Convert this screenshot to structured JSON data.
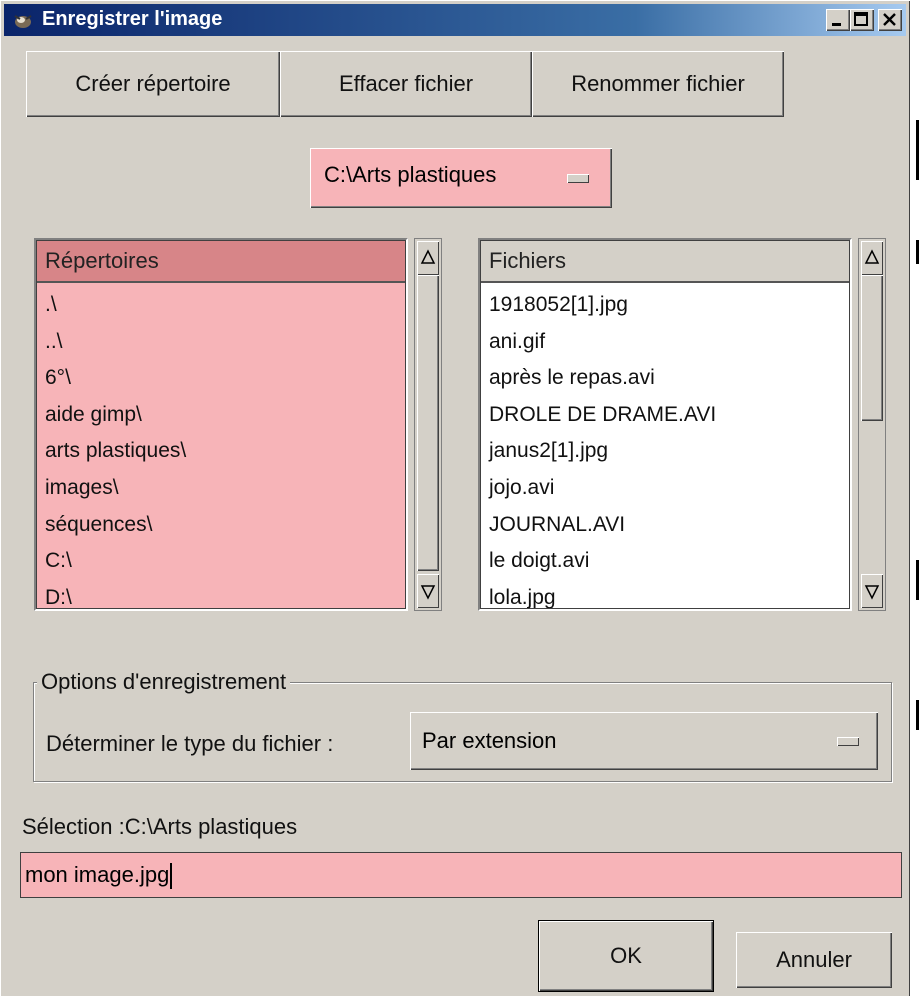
{
  "window": {
    "title": "Enregistrer l'image"
  },
  "toolbar": {
    "create_dir": "Créer répertoire",
    "delete_file": "Effacer fichier",
    "rename_file": "Renommer fichier"
  },
  "path_selector": {
    "value": "C:\\Arts plastiques"
  },
  "directories": {
    "header": "Répertoires",
    "items": [
      ".\\",
      "..\\",
      "6°\\",
      "aide gimp\\",
      "arts plastiques\\",
      "images\\",
      "séquences\\",
      "C:\\",
      "D:\\"
    ]
  },
  "files": {
    "header": "Fichiers",
    "items": [
      "1918052[1].jpg",
      "ani.gif",
      "après le repas.avi",
      "DROLE DE DRAME.AVI",
      "janus2[1].jpg",
      "jojo.avi",
      "JOURNAL.AVI",
      "le doigt.avi",
      "lola.jpg"
    ]
  },
  "save_options": {
    "legend": "Options d'enregistrement",
    "type_label": "Déterminer le type du fichier :",
    "type_value": "Par extension"
  },
  "selection": {
    "label": "Sélection :C:\\Arts plastiques",
    "filename": "mon image.jpg"
  },
  "buttons": {
    "ok": "OK",
    "cancel": "Annuler"
  },
  "colors": {
    "pink": "#f7b4b8",
    "pink_header": "#d78588",
    "title_bar": "#0a246a",
    "window_bg": "#d4d0c8"
  }
}
